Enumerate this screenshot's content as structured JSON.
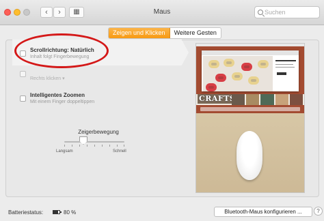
{
  "window": {
    "title": "Maus"
  },
  "toolbar": {
    "back_glyph": "‹",
    "forward_glyph": "›",
    "grid_glyph": "▦"
  },
  "search": {
    "placeholder": "Suchen",
    "value": ""
  },
  "tabs": [
    {
      "label": "Zeigen und Klicken",
      "active": true
    },
    {
      "label": "Weitere Gesten",
      "active": false
    }
  ],
  "options": [
    {
      "title": "Scrollrichtung: Natürlich",
      "subtitle": "Inhalt folgt Fingerbewegung",
      "checked": false
    },
    {
      "title": "",
      "subtitle": "Rechts klicken ▾",
      "checked": false
    },
    {
      "title": "Intelligentes Zoomen",
      "subtitle": "Mit einem Finger doppeltippen",
      "checked": false
    }
  ],
  "tracking": {
    "label": "Zeigerbewegung",
    "min_label": "Langsam",
    "max_label": "Schnell",
    "value_fraction": 0.3
  },
  "preview": {
    "site_name": "CRAFTS"
  },
  "footer": {
    "battery_label": "Batteriestatus:",
    "battery_value": "80 %",
    "bluetooth_button": "Bluetooth-Maus konfigurieren ...",
    "help_label": "?"
  },
  "colors": {
    "accent": "#f89a12",
    "annotation": "#d41818"
  }
}
